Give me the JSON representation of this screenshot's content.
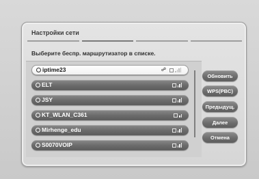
{
  "dialog": {
    "title": "Настройки сети",
    "subtitle": "Выберите беспр. маршрутизатор в списке.",
    "progress_steps": 4,
    "progress_active_step": 2
  },
  "networks": [
    {
      "name": "iptime23",
      "selected": true
    },
    {
      "name": "ELT",
      "selected": false
    },
    {
      "name": "JSY",
      "selected": false
    },
    {
      "name": "KT_WLAN_C361",
      "selected": false
    },
    {
      "name": "Mirhenge_edu",
      "selected": false
    },
    {
      "name": "S0070VOIP",
      "selected": false
    }
  ],
  "buttons": {
    "refresh": "Обновить",
    "wps": "WPS(PBC)",
    "previous": "Предыдущ.",
    "next": "Далее",
    "cancel": "Отмена"
  }
}
